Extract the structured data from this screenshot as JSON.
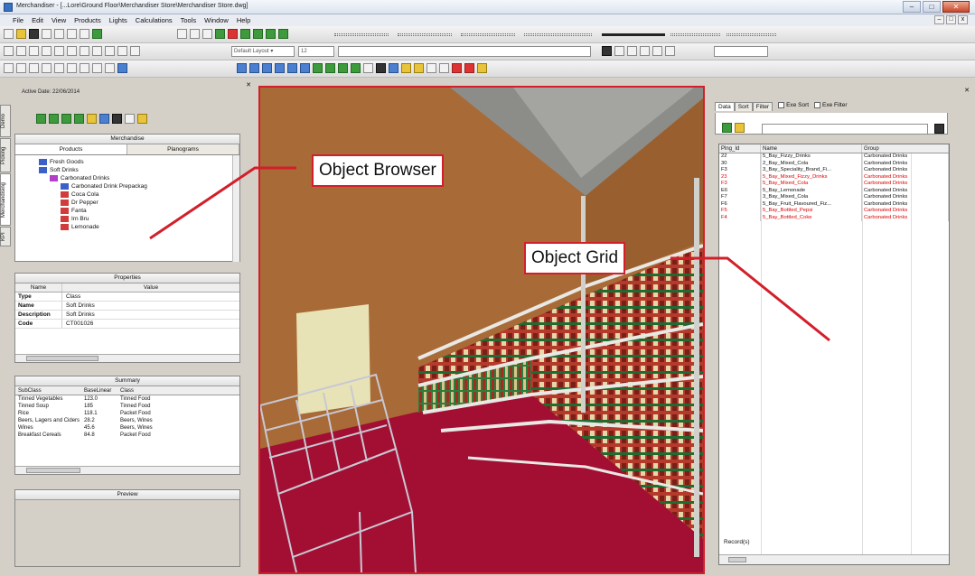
{
  "app": {
    "title": "Merchandiser - [...Lore\\Ground Floor\\Merchandiser Store\\Merchandiser Store.dwg]",
    "menu": [
      "File",
      "Edit",
      "View",
      "Products",
      "Lights",
      "Calculations",
      "Tools",
      "Window",
      "Help"
    ],
    "win_buttons": {
      "minimize": "–",
      "maximize": "□",
      "close": "✕"
    },
    "doc_buttons": {
      "minimize": "–",
      "maximize": "□",
      "close": "x"
    }
  },
  "toolbar": {
    "layer_combo": "Default Layout ▾",
    "size_combo": "12"
  },
  "left_panel": {
    "active_date": "Active Date: 22/06/2014",
    "vertical_tabs": [
      "Demo",
      "Picking",
      "Merchandising",
      "KPI"
    ],
    "merchandise": {
      "header": "Merchandise",
      "tabs": [
        "Products",
        "Planograms"
      ],
      "tree": [
        {
          "label": "Fresh Goods",
          "folder": "fb",
          "indent": 0
        },
        {
          "label": "Soft Drinks",
          "folder": "fb",
          "indent": 0
        },
        {
          "label": "Carbonated Drinks",
          "folder": "fp",
          "indent": 1
        },
        {
          "label": "Carbonated Drink Prepackag",
          "folder": "fb",
          "indent": 2
        },
        {
          "label": "Coca Cola",
          "folder": "fr",
          "indent": 2
        },
        {
          "label": "Dr Pepper",
          "folder": "fr",
          "indent": 2
        },
        {
          "label": "Fanta",
          "folder": "fr",
          "indent": 2
        },
        {
          "label": "Irn Bru",
          "folder": "fr",
          "indent": 2
        },
        {
          "label": "Lemonade",
          "folder": "fr",
          "indent": 2
        }
      ]
    },
    "properties": {
      "header": "Properties",
      "col_name": "Name",
      "col_value": "Value",
      "rows": [
        {
          "k": "Type",
          "v": "Class"
        },
        {
          "k": "Name",
          "v": "Soft Drinks"
        },
        {
          "k": "Description",
          "v": "Soft Drinks"
        },
        {
          "k": "Code",
          "v": "CT001026"
        }
      ]
    },
    "summary": {
      "header": "Summary",
      "columns": [
        "SubClass",
        "BaseLinear",
        "Class"
      ],
      "rows": [
        [
          "Tinned Vegetables",
          "123.0",
          "Tinned Food"
        ],
        [
          "Tinned Soup",
          "185",
          "Tinned Food"
        ],
        [
          "Rice",
          "118.1",
          "Packet Food"
        ],
        [
          "Beers, Lagers and Ciders",
          "28.2",
          "Beers, Wines"
        ],
        [
          "Wines",
          "45.6",
          "Beers, Wines"
        ],
        [
          "Breakfast Cereals",
          "84.8",
          "Packet Food"
        ]
      ]
    },
    "preview": {
      "header": "Preview"
    }
  },
  "right_panel": {
    "tabs": [
      "Data",
      "Sort",
      "Filter"
    ],
    "checks": [
      "Exe Sort",
      "Exe Filter"
    ],
    "columns": [
      "Plng_Id",
      "Name",
      "Group"
    ],
    "rows": [
      {
        "id": "22",
        "name": "5_Bay_Fizzy_Drinks",
        "group": "Carbonated Drinks",
        "red": false
      },
      {
        "id": "30",
        "name": "2_Bay_Mixed_Cola",
        "group": "Carbonated Drinks",
        "red": false
      },
      {
        "id": "F3",
        "name": "3_Bay_Speciality_Brand_Fi...",
        "group": "Carbonated Drinks",
        "red": false
      },
      {
        "id": "23",
        "name": "5_Bay_Mixed_Fizzy_Drinks",
        "group": "Carbonated Drinks",
        "red": true
      },
      {
        "id": "F3",
        "name": "5_Bay_Mixed_Cola",
        "group": "Carbonated Drinks",
        "red": true
      },
      {
        "id": "E6",
        "name": "5_Bay_Lemonade",
        "group": "Carbonated Drinks",
        "red": false
      },
      {
        "id": "F7",
        "name": "3_Bay_Mixed_Cola",
        "group": "Carbonated Drinks",
        "red": false
      },
      {
        "id": "F6",
        "name": "5_Bay_Fruit_Flavoured_Fiz...",
        "group": "Carbonated Drinks",
        "red": false
      },
      {
        "id": "F5",
        "name": "5_Bay_Bottled_Pepsi",
        "group": "Carbonated Drinks",
        "red": true
      },
      {
        "id": "F4",
        "name": "5_Bay_Bottled_Coke",
        "group": "Carbonated Drinks",
        "red": true
      }
    ],
    "records": "Record(s)"
  },
  "callouts": {
    "object_browser": "Object Browser",
    "object_grid": "Object Grid"
  },
  "colors": {
    "callout_red": "#d21f2a",
    "wall": "#a86a36",
    "floor": "#a20f33",
    "shelf": "#dcdcd8"
  }
}
